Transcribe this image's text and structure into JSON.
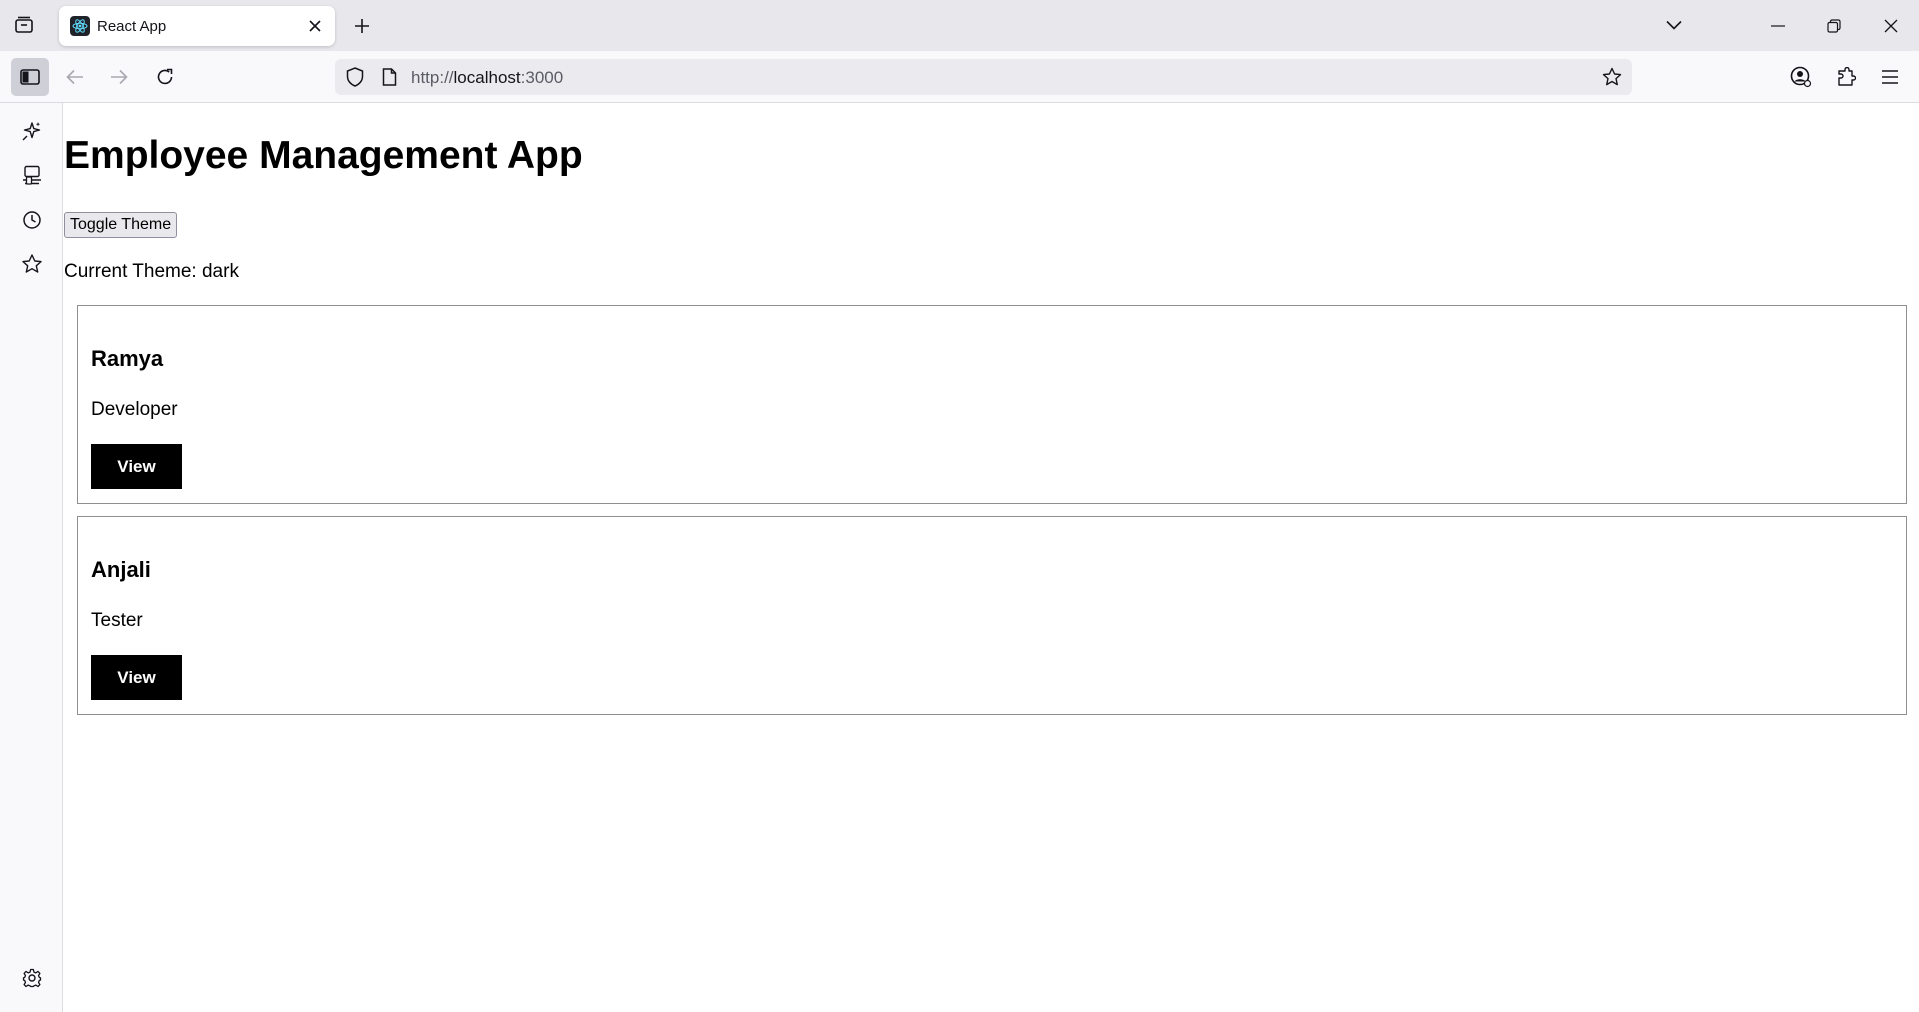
{
  "browser": {
    "tab": {
      "title": "React App"
    },
    "url": {
      "scheme": "http://",
      "host": "localhost",
      "port": ":3000"
    },
    "icons": {
      "tab_overview": "tab-overview-icon",
      "favicon": "react-atom-icon",
      "tab_close": "close-icon",
      "new_tab": "plus-icon",
      "tab_list": "chevron-down-icon",
      "minimize": "minimize-icon",
      "restore": "restore-icon",
      "close_window": "close-icon",
      "sidebar_toggle": "sidebar-icon",
      "back": "arrow-left-icon",
      "forward": "arrow-right-icon",
      "reload": "reload-icon",
      "shield": "shield-icon",
      "page": "page-icon",
      "bookmark": "star-icon",
      "account": "account-icon",
      "extensions": "puzzle-icon",
      "menu": "hamburger-icon"
    }
  },
  "sidebar": {
    "items": [
      {
        "icon": "ai-sparkle-icon"
      },
      {
        "icon": "synced-tabs-icon"
      },
      {
        "icon": "history-icon"
      },
      {
        "icon": "bookmarks-star-icon"
      }
    ],
    "settings_icon": "gear-icon"
  },
  "page": {
    "title": "Employee Management App",
    "toggle_button": "Toggle Theme",
    "theme_line": "Current Theme: dark",
    "employees": [
      {
        "name": "Ramya",
        "role": "Developer",
        "button": "View"
      },
      {
        "name": "Anjali",
        "role": "Tester",
        "button": "View"
      }
    ]
  },
  "colors": {
    "tabstrip_bg": "#e8e7ec",
    "toolbar_bg": "#f9f9fb",
    "urlbar_bg": "#ebebef",
    "card_border": "#8f8f8f",
    "view_button_bg": "#000000",
    "view_button_text": "#ffffff"
  }
}
